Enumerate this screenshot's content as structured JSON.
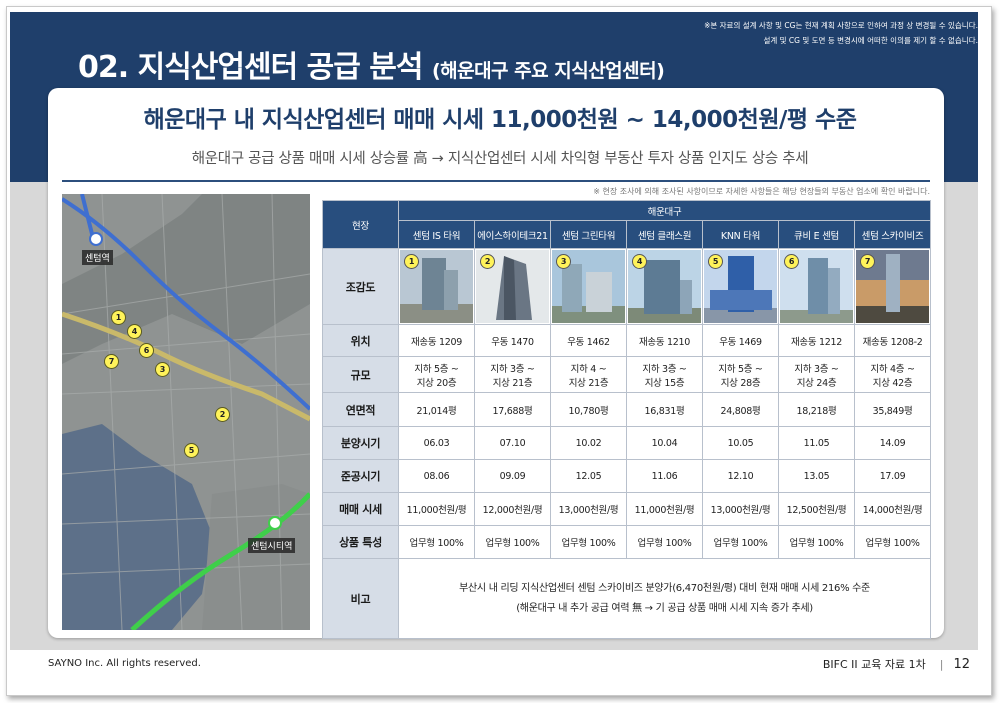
{
  "disclaimer": {
    "line1": "※본 자료의 설계 사항 및 CG는 현재 계획 사항으로 인하여 과정 상 변경될 수 있습니다.",
    "line2": "설계 및 CG 및 도면 등 변경시에 어떠한 이의를 제기 할 수 없습니다."
  },
  "title": {
    "main": "02. 지식산업센터 공급 분석",
    "sub": "(해운대구 주요 지식산업센터)"
  },
  "headline": "해운대구 내 지식산업센터 매매 시세 11,000천원 ~ 14,000천원/평 수준",
  "subline": "해운대구 공급 상품 매매 시세 상승률 高 → 지식산업센터 시세 차익형 부동산 투자 상품 인지도 상승 추세",
  "note": "※ 현장 조사에 의해 조사된 사항이므로 자세한 사항들은 해당 현장들의 부동산 업소에 확인 바랍니다.",
  "map": {
    "station_top": "센텀역",
    "station_bottom": "센텀시티역",
    "pins": [
      "1",
      "2",
      "3",
      "4",
      "5",
      "6",
      "7"
    ]
  },
  "table": {
    "corner": "현장",
    "region": "해운대구",
    "columns": [
      "센텀 IS 타워",
      "에이스하이테크21",
      "센텀 그린타워",
      "센텀 클래스원",
      "KNN 타워",
      "큐비 E 센텀",
      "센텀 스카이비즈"
    ],
    "rows": {
      "photo_label": "조감도",
      "location": {
        "label": "위치",
        "values": [
          "재송동 1209",
          "우동 1470",
          "우동 1462",
          "재송동 1210",
          "우동 1469",
          "재송동 1212",
          "재송동 1208-2"
        ]
      },
      "scale": {
        "label": "규모",
        "values": [
          [
            "지하 5층 ~",
            "지상 20층"
          ],
          [
            "지하 3층 ~",
            "지상 21층"
          ],
          [
            "지하 4 ~",
            "지상 21층"
          ],
          [
            "지하 3층 ~",
            "지상 15층"
          ],
          [
            "지하 5층 ~",
            "지상 28층"
          ],
          [
            "지하 3층 ~",
            "지상 24층"
          ],
          [
            "지하 4층 ~",
            "지상 42층"
          ]
        ]
      },
      "area": {
        "label": "연면적",
        "values": [
          "21,014평",
          "17,688평",
          "10,780평",
          "16,831평",
          "24,808평",
          "18,218평",
          "35,849평"
        ]
      },
      "sale": {
        "label": "분양시기",
        "values": [
          "06.03",
          "07.10",
          "10.02",
          "10.04",
          "10.05",
          "11.05",
          "14.09"
        ]
      },
      "done": {
        "label": "준공시기",
        "values": [
          "08.06",
          "09.09",
          "12.05",
          "11.06",
          "12.10",
          "13.05",
          "17.09"
        ]
      },
      "price": {
        "label": "매매 시세",
        "values": [
          "11,000천원/평",
          "12,000천원/평",
          "13,000천원/평",
          "11,000천원/평",
          "13,000천원/평",
          "12,500천원/평",
          "14,000천원/평"
        ]
      },
      "feature": {
        "label": "상품 특성",
        "values": [
          "업무형 100%",
          "업무형 100%",
          "업무형 100%",
          "업무형 100%",
          "업무형 100%",
          "업무형 100%",
          "업무형 100%"
        ]
      },
      "remark": {
        "label": "비고",
        "line1": "부산시 내 리딩 지식산업센터 센텀 스카이비즈 분양가(6,470천원/평) 대비 현재 매매 시세 216% 수준",
        "line2": "(해운대구 내 추가 공급 여력 無 → 기 공급 상품 매매 시세 지속 증가 추세)"
      }
    }
  },
  "footer": {
    "left": "SAYNO Inc. All rights reserved.",
    "right": "BIFC II 교육 자료 1차",
    "page": "12"
  },
  "colors": {
    "navy": "#1f3f6b",
    "table_header": "#284e7e",
    "row_header": "#d6dde7",
    "pin": "#fff35a"
  }
}
